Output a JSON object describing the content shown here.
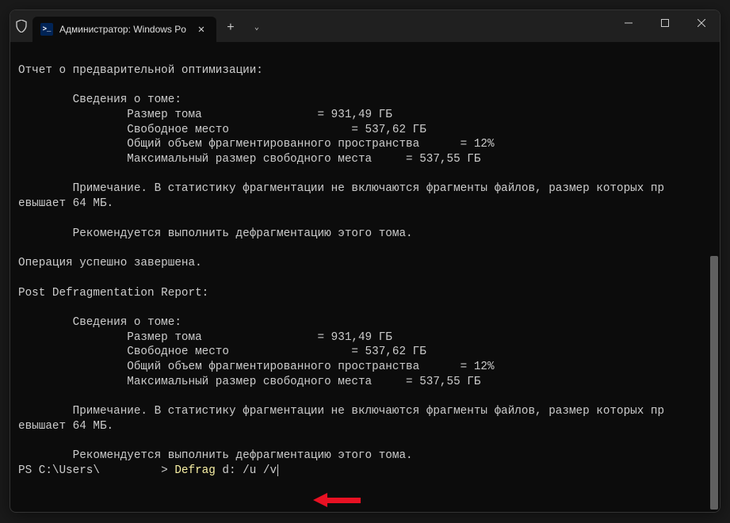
{
  "titlebar": {
    "tab_title": "Администратор: Windows Po",
    "close_glyph": "✕",
    "plus_glyph": "+",
    "chevron_glyph": "⌄",
    "ps_icon_text": ">_"
  },
  "terminal": {
    "lines": [
      "",
      "Отчет о предварительной оптимизации:",
      "",
      "        Сведения о томе:",
      "                Размер тома                 = 931,49 ГБ",
      "                Свободное место                  = 537,62 ГБ",
      "                Общий объем фрагментированного пространства      = 12%",
      "                Максимальный размер свободного места     = 537,55 ГБ",
      "",
      "        Примечание. В статистику фрагментации не включаются фрагменты файлов, размер которых пр",
      "евышает 64 МБ.",
      "",
      "        Рекомендуется выполнить дефрагментацию этого тома.",
      "",
      "Операция успешно завершена.",
      "",
      "Post Defragmentation Report:",
      "",
      "        Сведения о томе:",
      "                Размер тома                 = 931,49 ГБ",
      "                Свободное место                  = 537,62 ГБ",
      "                Общий объем фрагментированного пространства      = 12%",
      "                Максимальный размер свободного места     = 537,55 ГБ",
      "",
      "        Примечание. В статистику фрагментации не включаются фрагменты файлов, размер которых пр",
      "евышает 64 МБ.",
      "",
      "        Рекомендуется выполнить дефрагментацию этого тома."
    ],
    "prompt_prefix": "PS C:\\Users\\         > ",
    "command_part1": "Defrag ",
    "command_part2": "d: /u /v"
  }
}
